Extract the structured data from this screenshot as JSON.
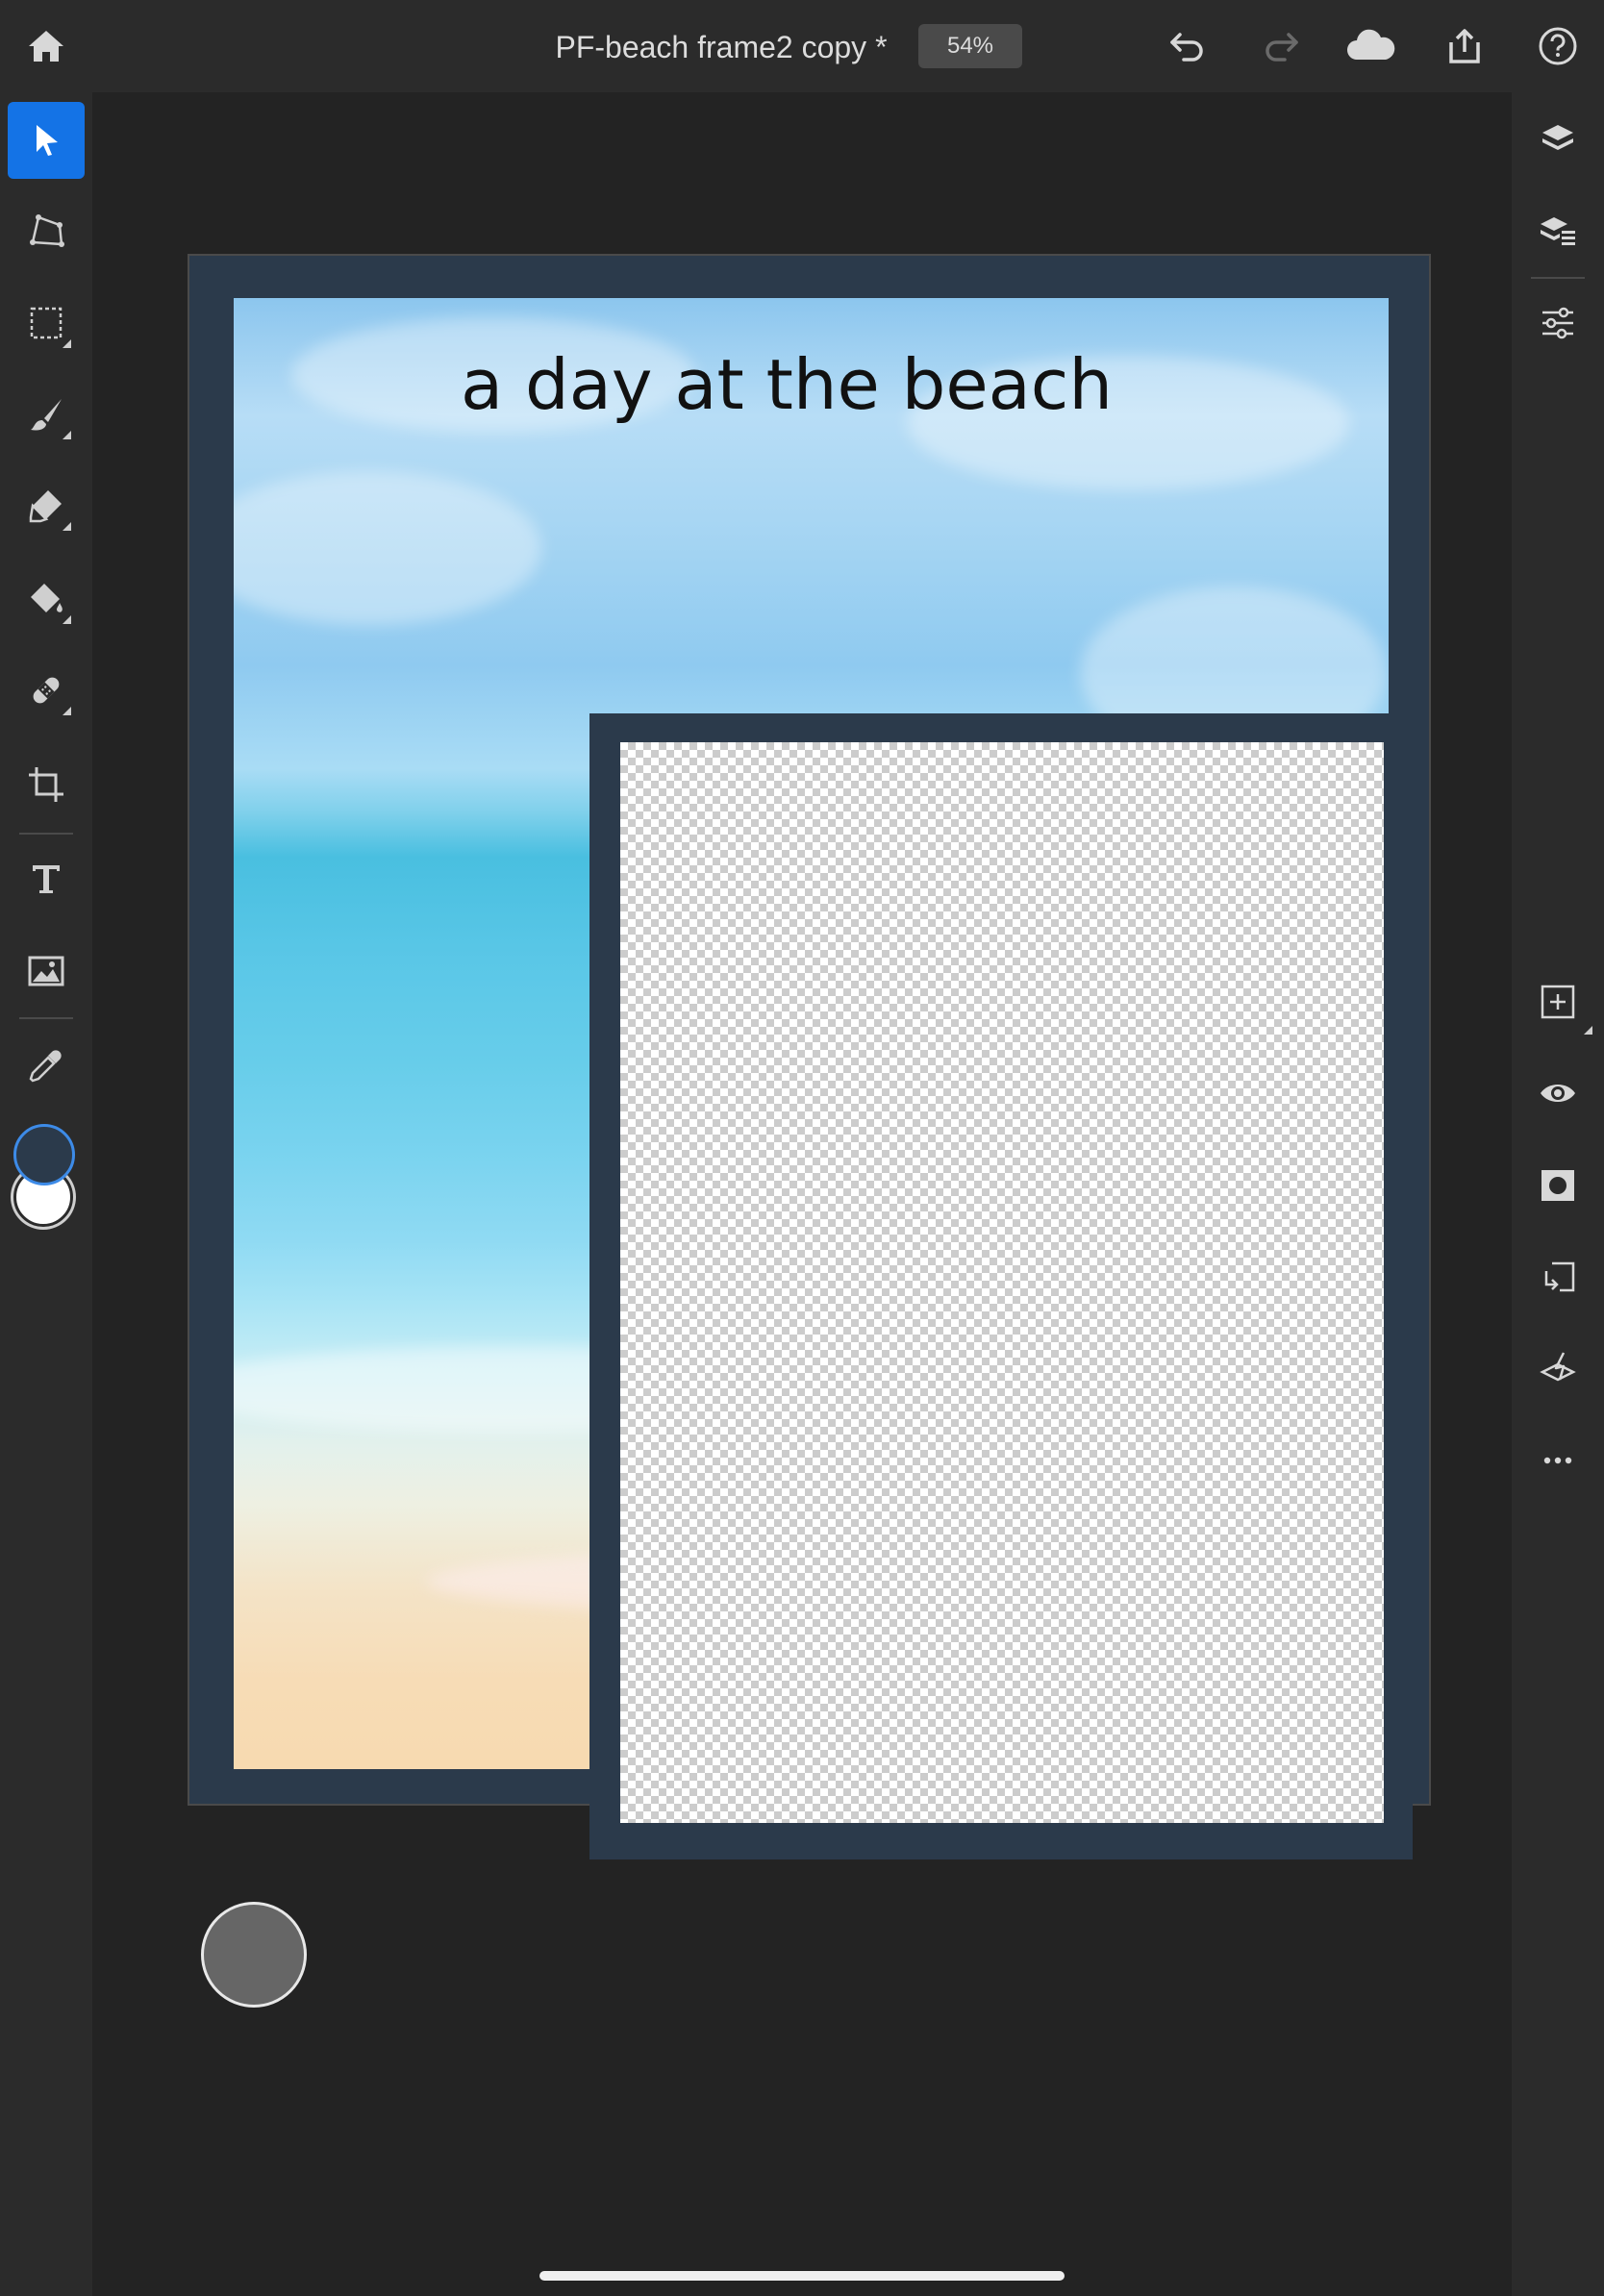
{
  "topbar": {
    "document_title": "PF-beach frame2 copy *",
    "zoom": "54%",
    "icons": [
      "home-icon",
      "undo-icon",
      "redo-icon",
      "cloud-icon",
      "share-icon",
      "help-icon"
    ]
  },
  "left_toolbar": {
    "tools": [
      "move-tool",
      "transform-tool",
      "selection-tool",
      "brush-tool",
      "eraser-tool",
      "fill-tool",
      "healing-tool",
      "crop-tool",
      "type-tool",
      "place-image-tool",
      "eyedropper-tool"
    ],
    "active_tool": "move-tool",
    "foreground_color": "#2b3a4b",
    "background_color": "#ffffff"
  },
  "right_panel": {
    "icons": [
      "layers-icon",
      "layer-properties-icon",
      "adjustments-icon",
      "add-layer-icon",
      "visibility-icon",
      "mask-icon",
      "clip-icon",
      "layer-effects-icon",
      "more-icon"
    ]
  },
  "canvas": {
    "artboard_color": "#2b3a4b",
    "title_text": "a day at the beach"
  }
}
